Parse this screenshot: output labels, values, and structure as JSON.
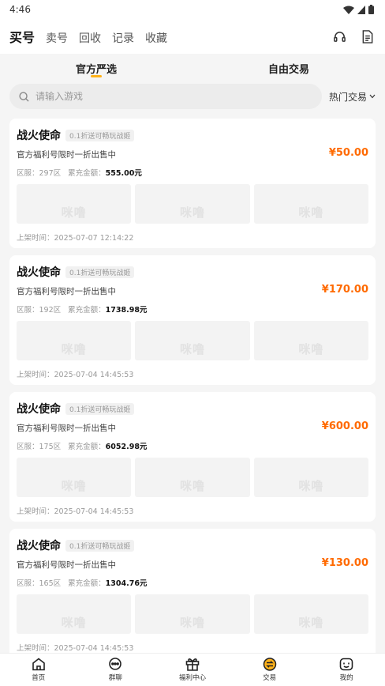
{
  "status_bar": {
    "time": "4:46"
  },
  "top_nav": {
    "tabs": [
      {
        "label": "买号",
        "active": true
      },
      {
        "label": "卖号",
        "active": false
      },
      {
        "label": "回收",
        "active": false
      },
      {
        "label": "记录",
        "active": false
      },
      {
        "label": "收藏",
        "active": false
      }
    ],
    "icons": [
      "headset-icon",
      "document-icon"
    ]
  },
  "sub_tabs": [
    {
      "label": "官方严选",
      "active": true
    },
    {
      "label": "自由交易",
      "active": false
    }
  ],
  "search": {
    "placeholder": "请输入游戏",
    "sort_label": "热门交易"
  },
  "listings": [
    {
      "title": "战火使命",
      "tag": "0.1折送可畅玩战姬",
      "subtitle": "官方福利号限时一折出售中",
      "price": "¥50.00",
      "server": "区服：297区",
      "recharge_label": "累充金额：",
      "recharge_value": "555.00元",
      "thumb_logo": "咪噜",
      "time": "上架时间：2025-07-07 12:14:22"
    },
    {
      "title": "战火使命",
      "tag": "0.1折送可畅玩战姬",
      "subtitle": "官方福利号限时一折出售中",
      "price": "¥170.00",
      "server": "区服：192区",
      "recharge_label": "累充金额：",
      "recharge_value": "1738.98元",
      "thumb_logo": "咪噜",
      "time": "上架时间：2025-07-04 14:45:53"
    },
    {
      "title": "战火使命",
      "tag": "0.1折送可畅玩战姬",
      "subtitle": "官方福利号限时一折出售中",
      "price": "¥600.00",
      "server": "区服：175区",
      "recharge_label": "累充金额：",
      "recharge_value": "6052.98元",
      "thumb_logo": "咪噜",
      "time": "上架时间：2025-07-04 14:45:53"
    },
    {
      "title": "战火使命",
      "tag": "0.1折送可畅玩战姬",
      "subtitle": "官方福利号限时一折出售中",
      "price": "¥130.00",
      "server": "区服：165区",
      "recharge_label": "累充金额：",
      "recharge_value": "1304.76元",
      "thumb_logo": "咪噜",
      "time": "上架时间：2025-07-04 14:45:53"
    }
  ],
  "bottom_nav": [
    {
      "label": "首页",
      "icon": "home-icon"
    },
    {
      "label": "群聊",
      "icon": "chat-icon"
    },
    {
      "label": "福利中心",
      "icon": "gift-icon"
    },
    {
      "label": "交易",
      "icon": "trade-icon"
    },
    {
      "label": "我的",
      "icon": "profile-icon"
    }
  ],
  "colors": {
    "accent": "#ffb21a",
    "price": "#ff6a00",
    "background": "#f5f5f5"
  }
}
